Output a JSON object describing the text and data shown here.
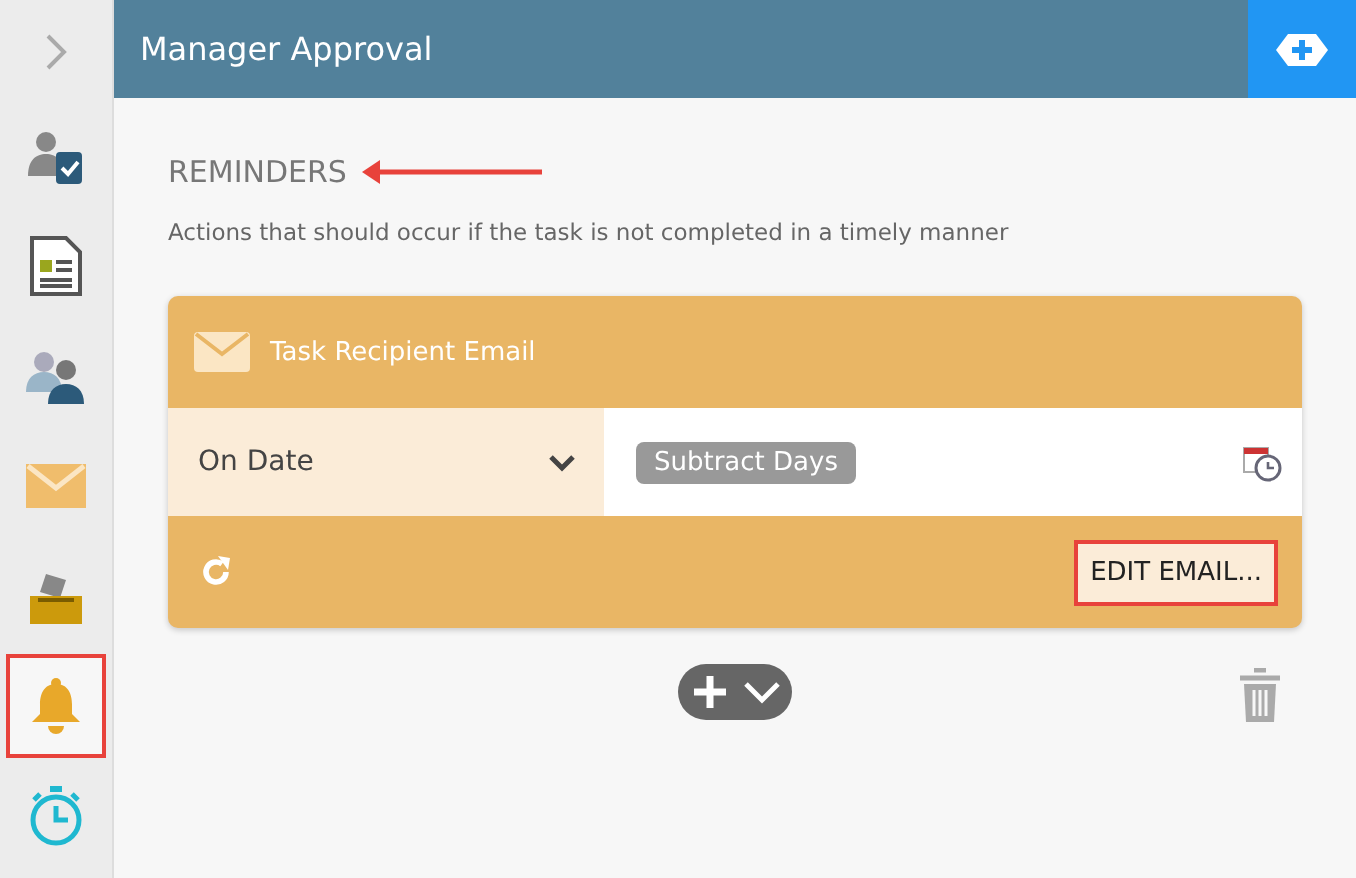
{
  "sidebar": {
    "items": [
      {
        "kind": "approval",
        "selected": false
      },
      {
        "kind": "form",
        "selected": false
      },
      {
        "kind": "users",
        "selected": false
      },
      {
        "kind": "email",
        "selected": false
      },
      {
        "kind": "ballot",
        "selected": false
      },
      {
        "kind": "bell",
        "selected": true
      },
      {
        "kind": "timer",
        "selected": false
      }
    ]
  },
  "header": {
    "title": "Manager Approval"
  },
  "section": {
    "title": "REMINDERS",
    "annotated": true,
    "description": "Actions that should occur if the task is not completed in a timely manner"
  },
  "reminders": [
    {
      "title": "Task Recipient Email",
      "trigger": "On Date",
      "tag": "Subtract Days",
      "button": "EDIT EMAIL...",
      "button_highlighted": true
    }
  ]
}
